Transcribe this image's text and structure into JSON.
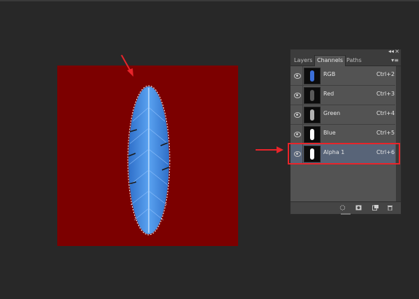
{
  "panel": {
    "controls": {
      "collapse": "◂◂",
      "close": "×",
      "menu": "▾≡"
    },
    "tabs": [
      {
        "label": "Layers",
        "active": false
      },
      {
        "label": "Channels",
        "active": true
      },
      {
        "label": "Paths",
        "active": false
      }
    ],
    "channels": [
      {
        "name": "RGB",
        "shortcut": "Ctrl+2",
        "thumb_color": "#3b6fd8",
        "selected": false
      },
      {
        "name": "Red",
        "shortcut": "Ctrl+3",
        "thumb_color": "#5a5a5a",
        "selected": false
      },
      {
        "name": "Green",
        "shortcut": "Ctrl+4",
        "thumb_color": "#b0b0b0",
        "selected": false
      },
      {
        "name": "Blue",
        "shortcut": "Ctrl+5",
        "thumb_color": "#ffffff",
        "selected": false
      },
      {
        "name": "Alpha 1",
        "shortcut": "Ctrl+6",
        "thumb_color": "#ffffff",
        "selected": true
      }
    ],
    "bottom_icons": [
      "load-selection-icon",
      "save-selection-icon",
      "new-channel-icon",
      "trash-icon"
    ]
  },
  "colors": {
    "canvas_background": "#7c0000",
    "feather": "#3a86e0",
    "annotation_red": "#e8242a",
    "selected_row": "#586478"
  }
}
